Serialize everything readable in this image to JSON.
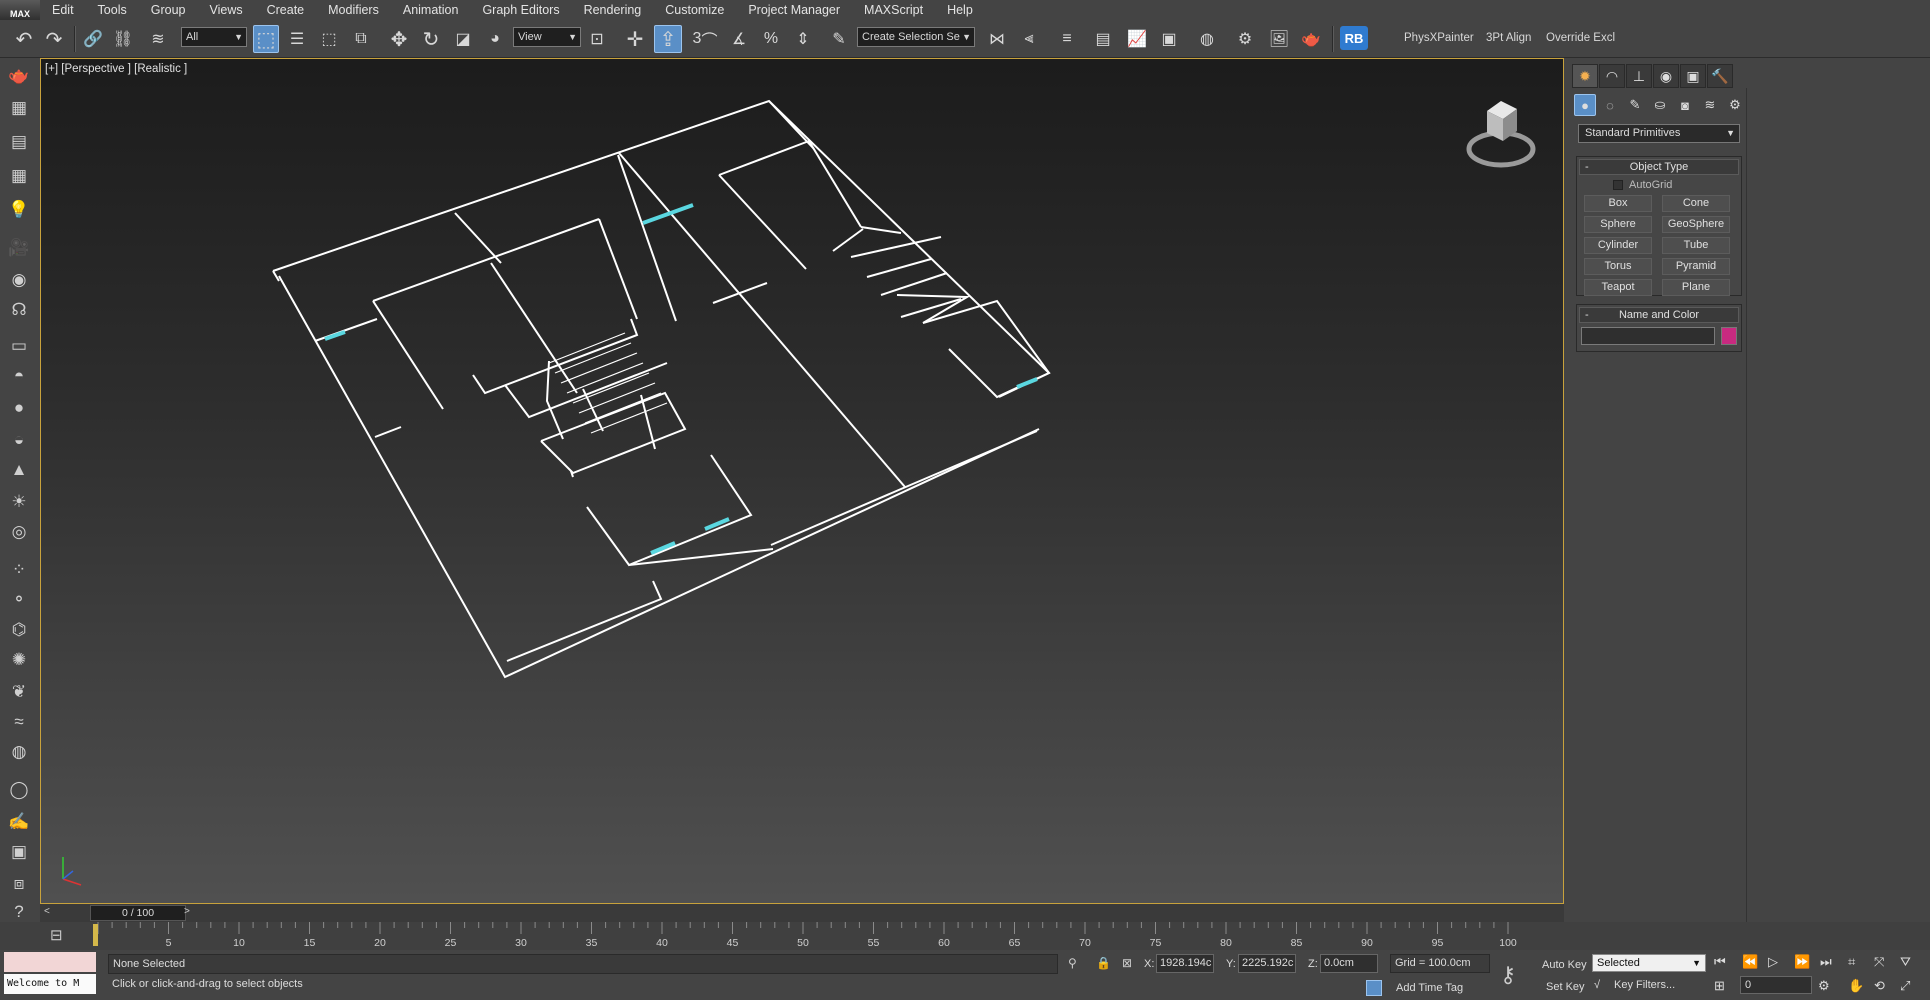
{
  "app": {
    "logo": "MAX"
  },
  "menu": [
    "Edit",
    "Tools",
    "Group",
    "Views",
    "Create",
    "Modifiers",
    "Animation",
    "Graph Editors",
    "Rendering",
    "Customize",
    "Project Manager",
    "MAXScript",
    "Help"
  ],
  "toolbar": {
    "selection_filter": "All",
    "ref_coord": "View",
    "named_selection_placeholder": "Create Selection Se",
    "snap_label": "3",
    "plugin_rb": "RB",
    "physx_painter": "PhysXPainter",
    "align_3pt": "3Pt Align",
    "override_excl": "Override Excl"
  },
  "viewport": {
    "label": "[+] [Perspective ] [Realistic ]",
    "grid_color": "#ffffff",
    "window_color": "#5ad7e0",
    "active_border": "#c8a23c"
  },
  "command_panel": {
    "tabs": [
      "create-icon",
      "modify-icon",
      "hierarchy-icon",
      "motion-icon",
      "display-icon",
      "utilities-icon"
    ],
    "subcategories": [
      "geometry-icon",
      "shapes-icon",
      "lights-icon",
      "cameras-icon",
      "helpers-icon",
      "spacewarps-icon",
      "systems-icon"
    ],
    "category": "Standard Primitives",
    "object_type": {
      "title": "Object Type",
      "autogrid": "AutoGrid",
      "buttons": [
        "Box",
        "Cone",
        "Sphere",
        "GeoSphere",
        "Cylinder",
        "Tube",
        "Torus",
        "Pyramid",
        "Teapot",
        "Plane"
      ]
    },
    "name_color": {
      "title": "Name and Color",
      "name": "",
      "color": "#c82a80"
    }
  },
  "timeline": {
    "position": "0 / 100",
    "ticks": [
      "5",
      "10",
      "15",
      "20",
      "25",
      "30",
      "35",
      "40",
      "45",
      "50",
      "55",
      "60",
      "65",
      "70",
      "75",
      "80",
      "85",
      "90",
      "95",
      "100"
    ]
  },
  "status": {
    "maxscript_output": "Welcome to M",
    "selection": "None Selected",
    "prompt": "Click or click-and-drag to select objects",
    "x_label": "X:",
    "x": "1928.194c",
    "y_label": "Y:",
    "y": "2225.192c",
    "z_label": "Z:",
    "z": "0.0cm",
    "grid": "Grid = 100.0cm",
    "add_time_tag": "Add Time Tag",
    "auto_key": "Auto Key",
    "set_key": "Set Key",
    "key_mode": "Selected",
    "key_filters": "Key Filters...",
    "frame": "0"
  }
}
